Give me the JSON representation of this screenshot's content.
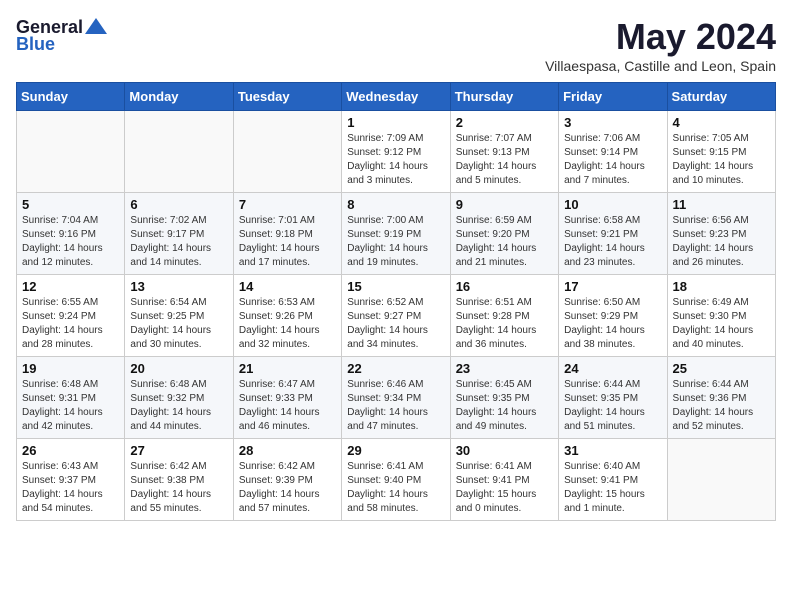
{
  "logo": {
    "line1": "General",
    "line2": "Blue"
  },
  "header": {
    "month": "May 2024",
    "location": "Villaespasa, Castille and Leon, Spain"
  },
  "weekdays": [
    "Sunday",
    "Monday",
    "Tuesday",
    "Wednesday",
    "Thursday",
    "Friday",
    "Saturday"
  ],
  "weeks": [
    [
      {
        "day": "",
        "info": ""
      },
      {
        "day": "",
        "info": ""
      },
      {
        "day": "",
        "info": ""
      },
      {
        "day": "1",
        "info": "Sunrise: 7:09 AM\nSunset: 9:12 PM\nDaylight: 14 hours\nand 3 minutes."
      },
      {
        "day": "2",
        "info": "Sunrise: 7:07 AM\nSunset: 9:13 PM\nDaylight: 14 hours\nand 5 minutes."
      },
      {
        "day": "3",
        "info": "Sunrise: 7:06 AM\nSunset: 9:14 PM\nDaylight: 14 hours\nand 7 minutes."
      },
      {
        "day": "4",
        "info": "Sunrise: 7:05 AM\nSunset: 9:15 PM\nDaylight: 14 hours\nand 10 minutes."
      }
    ],
    [
      {
        "day": "5",
        "info": "Sunrise: 7:04 AM\nSunset: 9:16 PM\nDaylight: 14 hours\nand 12 minutes."
      },
      {
        "day": "6",
        "info": "Sunrise: 7:02 AM\nSunset: 9:17 PM\nDaylight: 14 hours\nand 14 minutes."
      },
      {
        "day": "7",
        "info": "Sunrise: 7:01 AM\nSunset: 9:18 PM\nDaylight: 14 hours\nand 17 minutes."
      },
      {
        "day": "8",
        "info": "Sunrise: 7:00 AM\nSunset: 9:19 PM\nDaylight: 14 hours\nand 19 minutes."
      },
      {
        "day": "9",
        "info": "Sunrise: 6:59 AM\nSunset: 9:20 PM\nDaylight: 14 hours\nand 21 minutes."
      },
      {
        "day": "10",
        "info": "Sunrise: 6:58 AM\nSunset: 9:21 PM\nDaylight: 14 hours\nand 23 minutes."
      },
      {
        "day": "11",
        "info": "Sunrise: 6:56 AM\nSunset: 9:23 PM\nDaylight: 14 hours\nand 26 minutes."
      }
    ],
    [
      {
        "day": "12",
        "info": "Sunrise: 6:55 AM\nSunset: 9:24 PM\nDaylight: 14 hours\nand 28 minutes."
      },
      {
        "day": "13",
        "info": "Sunrise: 6:54 AM\nSunset: 9:25 PM\nDaylight: 14 hours\nand 30 minutes."
      },
      {
        "day": "14",
        "info": "Sunrise: 6:53 AM\nSunset: 9:26 PM\nDaylight: 14 hours\nand 32 minutes."
      },
      {
        "day": "15",
        "info": "Sunrise: 6:52 AM\nSunset: 9:27 PM\nDaylight: 14 hours\nand 34 minutes."
      },
      {
        "day": "16",
        "info": "Sunrise: 6:51 AM\nSunset: 9:28 PM\nDaylight: 14 hours\nand 36 minutes."
      },
      {
        "day": "17",
        "info": "Sunrise: 6:50 AM\nSunset: 9:29 PM\nDaylight: 14 hours\nand 38 minutes."
      },
      {
        "day": "18",
        "info": "Sunrise: 6:49 AM\nSunset: 9:30 PM\nDaylight: 14 hours\nand 40 minutes."
      }
    ],
    [
      {
        "day": "19",
        "info": "Sunrise: 6:48 AM\nSunset: 9:31 PM\nDaylight: 14 hours\nand 42 minutes."
      },
      {
        "day": "20",
        "info": "Sunrise: 6:48 AM\nSunset: 9:32 PM\nDaylight: 14 hours\nand 44 minutes."
      },
      {
        "day": "21",
        "info": "Sunrise: 6:47 AM\nSunset: 9:33 PM\nDaylight: 14 hours\nand 46 minutes."
      },
      {
        "day": "22",
        "info": "Sunrise: 6:46 AM\nSunset: 9:34 PM\nDaylight: 14 hours\nand 47 minutes."
      },
      {
        "day": "23",
        "info": "Sunrise: 6:45 AM\nSunset: 9:35 PM\nDaylight: 14 hours\nand 49 minutes."
      },
      {
        "day": "24",
        "info": "Sunrise: 6:44 AM\nSunset: 9:35 PM\nDaylight: 14 hours\nand 51 minutes."
      },
      {
        "day": "25",
        "info": "Sunrise: 6:44 AM\nSunset: 9:36 PM\nDaylight: 14 hours\nand 52 minutes."
      }
    ],
    [
      {
        "day": "26",
        "info": "Sunrise: 6:43 AM\nSunset: 9:37 PM\nDaylight: 14 hours\nand 54 minutes."
      },
      {
        "day": "27",
        "info": "Sunrise: 6:42 AM\nSunset: 9:38 PM\nDaylight: 14 hours\nand 55 minutes."
      },
      {
        "day": "28",
        "info": "Sunrise: 6:42 AM\nSunset: 9:39 PM\nDaylight: 14 hours\nand 57 minutes."
      },
      {
        "day": "29",
        "info": "Sunrise: 6:41 AM\nSunset: 9:40 PM\nDaylight: 14 hours\nand 58 minutes."
      },
      {
        "day": "30",
        "info": "Sunrise: 6:41 AM\nSunset: 9:41 PM\nDaylight: 15 hours\nand 0 minutes."
      },
      {
        "day": "31",
        "info": "Sunrise: 6:40 AM\nSunset: 9:41 PM\nDaylight: 15 hours\nand 1 minute."
      },
      {
        "day": "",
        "info": ""
      }
    ]
  ]
}
